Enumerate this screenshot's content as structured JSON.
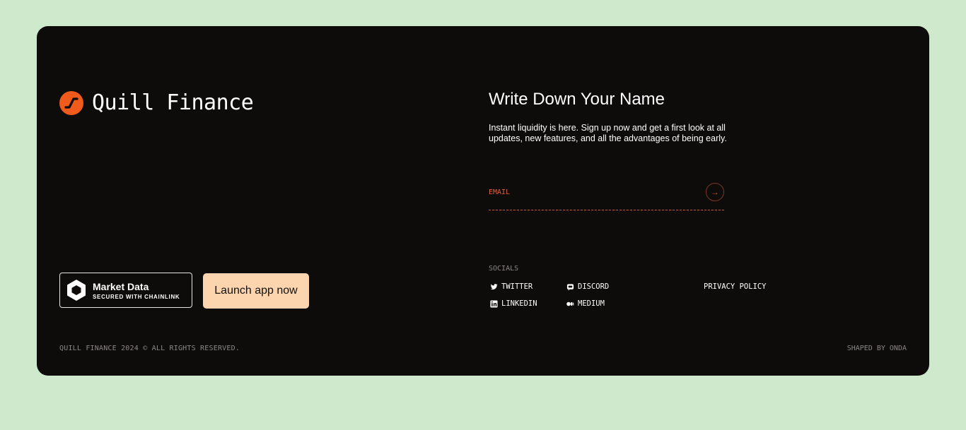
{
  "brand": {
    "name": "Quill Finance",
    "accent": "#f05a1a"
  },
  "badge": {
    "title": "Market Data",
    "subtitle": "SECURED WITH CHAINLINK"
  },
  "cta": {
    "launch_label": "Launch app now",
    "color": "#fcd4ad"
  },
  "signup": {
    "heading": "Write Down Your Name",
    "description": "Instant liquidity is here. Sign up now and get a first look at all updates, new features, and all the advantages of being early.",
    "email_placeholder": "EMAIL",
    "submit_icon": "arrow-right-icon"
  },
  "socials": {
    "label": "SOCIALS",
    "items": [
      {
        "label": "TWITTER",
        "icon": "twitter-icon"
      },
      {
        "label": "DISCORD",
        "icon": "discord-icon"
      },
      {
        "label": "LINKEDIN",
        "icon": "linkedin-icon"
      },
      {
        "label": "MEDIUM",
        "icon": "medium-icon"
      }
    ],
    "privacy_label": "PRIVACY POLICY"
  },
  "footer": {
    "copyright": "QUILL FINANCE 2024 © ALL RIGHTS RESERVED.",
    "credit": "SHAPED BY ONDA"
  }
}
